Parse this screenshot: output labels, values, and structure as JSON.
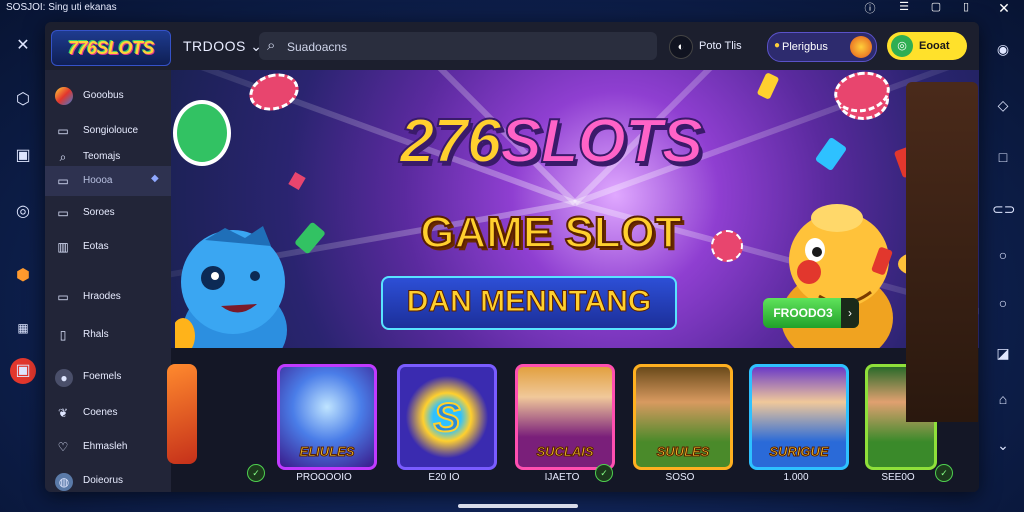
{
  "status_bar": {
    "text": "SOSJOI: Sing uti ekanas"
  },
  "system_icons": [
    "help-circle-icon",
    "tune-icon",
    "window-icon",
    "phone-icon",
    "close-icon"
  ],
  "header": {
    "brand": "776SLOTS",
    "app_title": "TRDOOS",
    "title_suffix": "⌄",
    "search_placeholder": "Suadoacns",
    "user_label": "Poto Tlis",
    "promo_label": "Plerigbus",
    "cta_label": "Eooat"
  },
  "sidebar": {
    "items": [
      {
        "label": "Gooobus",
        "icon": "avatar-icon"
      },
      {
        "label": "Songiolouce",
        "icon": "list-icon"
      },
      {
        "label": "Teomajs",
        "icon": "search-icon"
      },
      {
        "label": "Hoooa",
        "icon": "folder-icon",
        "active": true
      },
      {
        "label": "Soroes",
        "icon": "grid-icon"
      },
      {
        "label": "Eotas",
        "icon": "copy-icon"
      },
      {
        "label": "Hraodes",
        "icon": "bookmark-icon"
      },
      {
        "label": "Rhals",
        "icon": "document-icon"
      },
      {
        "label": "Foemels",
        "icon": "user-icon"
      },
      {
        "label": "Coenes",
        "icon": "leaf-icon"
      },
      {
        "label": "Ehmasleh",
        "icon": "heart-icon"
      },
      {
        "label": "Doieorus",
        "icon": "globe-icon"
      }
    ]
  },
  "banner": {
    "title_part1": "276",
    "title_part2": "SLOTS",
    "subtitle": "GAME SLOT",
    "tagline": "DAN MENNTANG",
    "button_label": "FROODO3",
    "button_arrow": "›"
  },
  "games": [
    {
      "title": "",
      "label": "",
      "color": "#e6502a"
    },
    {
      "title": "ELIULES",
      "label": "PROOOOIO",
      "color": "#6a2fd0"
    },
    {
      "title": "S",
      "label": "E20 IO",
      "color": "#3a2bb0"
    },
    {
      "title": "SUCLAIS",
      "label": "IJAETO",
      "color": "#c02fb0"
    },
    {
      "title": "SUULES",
      "label": "SOSO",
      "color": "#e6a020"
    },
    {
      "title": "SURIGUE",
      "label": "1.000",
      "color": "#2a9ad8"
    },
    {
      "title": "",
      "label": "SEE0O",
      "color": "#6fc02a"
    }
  ],
  "right_rail_icons": [
    "android-icon",
    "diamond-icon",
    "square-icon",
    "link-icon",
    "circle-icon",
    "circle-outline-icon",
    "frame-icon",
    "home-icon",
    "chevron-down-icon"
  ],
  "left_rail_icons": [
    "arrows-icon",
    "hexagon-icon",
    "calendar-icon",
    "shield-icon",
    "gem-icon",
    "grid-icon",
    "gift-icon"
  ]
}
